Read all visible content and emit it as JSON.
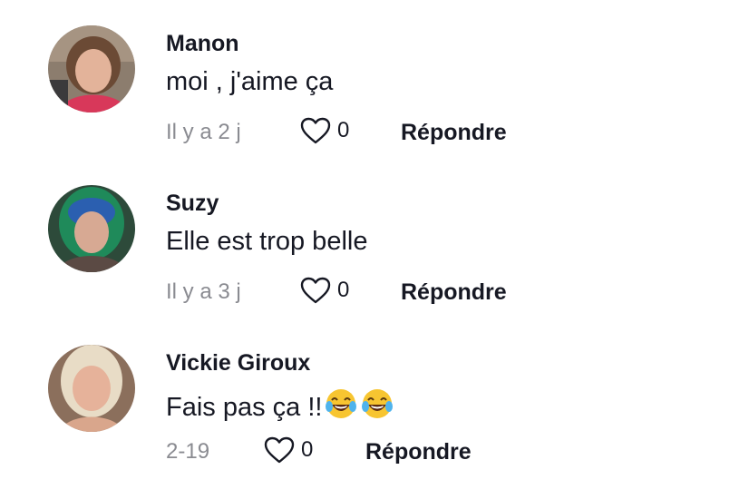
{
  "comments": [
    {
      "author": "Manon",
      "text": "moi , j'aime ça",
      "time": "Il y a 2 j",
      "likes": "0",
      "reply_label": "Répondre",
      "icons": {
        "like": "heart-outline-icon"
      }
    },
    {
      "author": "Suzy",
      "text": "Elle est trop belle",
      "time": "Il y a 3 j",
      "likes": "0",
      "reply_label": "Répondre",
      "icons": {
        "like": "heart-outline-icon"
      }
    },
    {
      "author": "Vickie Giroux",
      "text": "Fais pas ça !!",
      "emojis": [
        "face-with-tears-of-joy",
        "face-with-tears-of-joy"
      ],
      "time": "2-19",
      "likes": "0",
      "reply_label": "Répondre",
      "icons": {
        "like": "heart-outline-icon"
      }
    }
  ],
  "colors": {
    "text": "#161823",
    "muted": "#8a8b91",
    "background": "#ffffff"
  }
}
